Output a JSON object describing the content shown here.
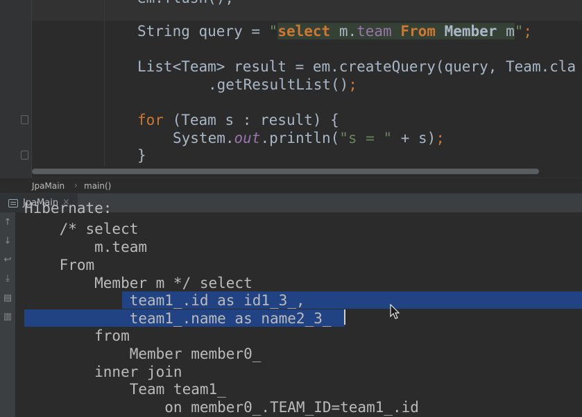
{
  "editor": {
    "line0": "em.flush();",
    "line1_lead": "String query = ",
    "line1_q_open": "\"",
    "line1_q_select": "select",
    "line1_q_m": " m.",
    "line1_q_team": "team",
    "line1_q_sp1": " ",
    "line1_q_from": "From",
    "line1_q_sp2": " ",
    "line1_q_member": "Member",
    "line1_q_m2": " m",
    "line1_q_close": "\"",
    "line1_semi": ";",
    "line2": "List<Team> result = em.createQuery(query, Team.cla",
    "line3_a": ".getResultList()",
    "line3_semi": ";",
    "line4_for": "for",
    "line4_rest": " (Team s : result) {",
    "line5_a": "System.",
    "line5_out": "out",
    "line5_b": ".println(",
    "line5_str": "\"s = \"",
    "line5_c": " + s)",
    "line5_semi": ";",
    "line6": "}"
  },
  "breadcrumb": {
    "class_name": "JpaMain",
    "separator": "›",
    "method_name": "main()"
  },
  "run": {
    "tab_label": "JpaMain",
    "tab_close": "×"
  },
  "console": {
    "lines": [
      "Hibernate:",
      "    /* select",
      "        m.team",
      "    From",
      "        Member m */ select",
      "            team1_.id as id1_3_,",
      "            team1_.name as name2_3_",
      "        from",
      "            Member member0_",
      "        inner join",
      "            Team team1_",
      "                on member0_.TEAM_ID=team1_.id"
    ]
  },
  "toolbar": {
    "icons": [
      "up-arrow-icon",
      "down-arrow-icon",
      "soft-wrap-icon",
      "scroll-to-end-icon",
      "print-icon",
      "trash-icon"
    ]
  },
  "colors": {
    "keyword": "#cc7832",
    "string": "#6a8759",
    "field": "#9876aa",
    "selection": "#214283",
    "background": "#2b2b2b"
  }
}
